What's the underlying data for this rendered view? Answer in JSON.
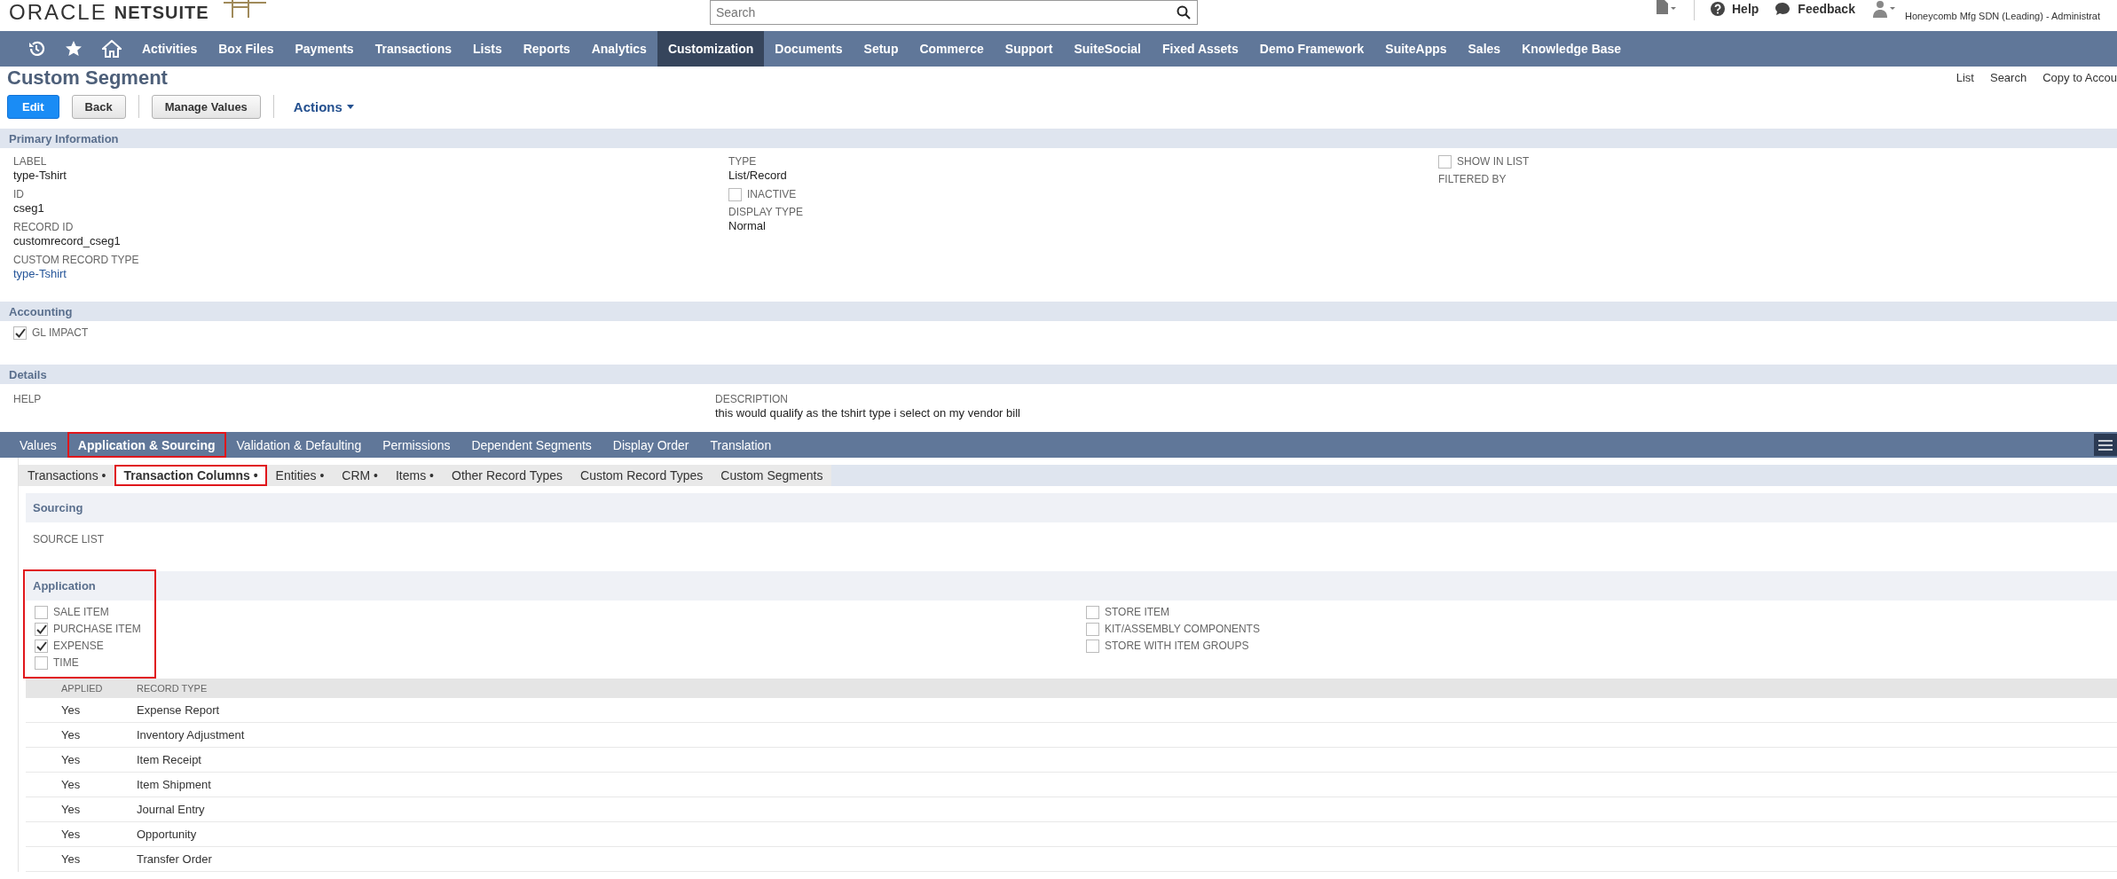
{
  "header": {
    "brand_primary": "ORACLE",
    "brand_secondary": "NETSUITE",
    "search": {
      "placeholder": "Search"
    },
    "links": [
      "Help",
      "Feedback"
    ],
    "account": "Honeycomb Mfg SDN (Leading) - Administrat"
  },
  "nav": {
    "items": [
      {
        "label": "Activities",
        "selected": false
      },
      {
        "label": "Box Files",
        "selected": false
      },
      {
        "label": "Payments",
        "selected": false
      },
      {
        "label": "Transactions",
        "selected": false
      },
      {
        "label": "Lists",
        "selected": false
      },
      {
        "label": "Reports",
        "selected": false
      },
      {
        "label": "Analytics",
        "selected": false
      },
      {
        "label": "Customization",
        "selected": true
      },
      {
        "label": "Documents",
        "selected": false
      },
      {
        "label": "Setup",
        "selected": false
      },
      {
        "label": "Commerce",
        "selected": false
      },
      {
        "label": "Support",
        "selected": false
      },
      {
        "label": "SuiteSocial",
        "selected": false
      },
      {
        "label": "Fixed Assets",
        "selected": false
      },
      {
        "label": "Demo Framework",
        "selected": false
      },
      {
        "label": "SuiteApps",
        "selected": false
      },
      {
        "label": "Sales",
        "selected": false
      },
      {
        "label": "Knowledge Base",
        "selected": false
      }
    ]
  },
  "page": {
    "title": "Custom Segment",
    "links": [
      "List",
      "Search",
      "Copy to Accou"
    ],
    "buttons": [
      {
        "label": "Edit",
        "kind": "primary"
      },
      {
        "label": "Back",
        "kind": "secondary"
      },
      {
        "label": "Manage Values",
        "kind": "secondary"
      }
    ],
    "actions": "Actions"
  },
  "primary_information": {
    "title": "Primary Information",
    "columns": [
      [
        {
          "kind": "field",
          "label": "LABEL",
          "value": "type-Tshirt"
        },
        {
          "kind": "field",
          "label": "ID",
          "value": "cseg1"
        },
        {
          "kind": "field",
          "label": "RECORD ID",
          "value": "customrecord_cseg1"
        },
        {
          "kind": "link",
          "label": "CUSTOM RECORD TYPE",
          "value": "type-Tshirt"
        }
      ],
      [
        {
          "kind": "field",
          "label": "TYPE",
          "value": "List/Record"
        },
        {
          "kind": "checkbox",
          "label": "INACTIVE",
          "checked": false
        },
        {
          "kind": "field",
          "label": "DISPLAY TYPE",
          "value": "Normal"
        }
      ],
      [
        {
          "kind": "checkbox",
          "label": "SHOW IN LIST",
          "checked": false
        },
        {
          "kind": "label",
          "label": "FILTERED BY"
        }
      ]
    ]
  },
  "accounting": {
    "title": "Accounting",
    "checkbox": {
      "label": "GL IMPACT",
      "checked": true
    }
  },
  "details": {
    "title": "Details",
    "help_label": "HELP",
    "description_label": "DESCRIPTION",
    "description": "this would qualify as the tshirt type i select on my vendor bill"
  },
  "tabs": [
    {
      "label": "Values",
      "selected": false,
      "highlighted": false
    },
    {
      "label": "Application & Sourcing",
      "selected": true,
      "highlighted": true
    },
    {
      "label": "Validation & Defaulting",
      "selected": false,
      "highlighted": false
    },
    {
      "label": "Permissions",
      "selected": false,
      "highlighted": false
    },
    {
      "label": "Dependent Segments",
      "selected": false,
      "highlighted": false
    },
    {
      "label": "Display Order",
      "selected": false,
      "highlighted": false
    },
    {
      "label": "Translation",
      "selected": false,
      "highlighted": false
    }
  ],
  "subtabs": [
    {
      "label": "Transactions •",
      "selected": false,
      "highlighted": false
    },
    {
      "label": "Transaction Columns •",
      "selected": true,
      "highlighted": true
    },
    {
      "label": "Entities •",
      "selected": false,
      "highlighted": false
    },
    {
      "label": "CRM •",
      "selected": false,
      "highlighted": false
    },
    {
      "label": "Items •",
      "selected": false,
      "highlighted": false
    },
    {
      "label": "Other Record Types",
      "selected": false,
      "highlighted": false
    },
    {
      "label": "Custom Record Types",
      "selected": false,
      "highlighted": false
    },
    {
      "label": "Custom Segments",
      "selected": false,
      "highlighted": false
    }
  ],
  "sourcing": {
    "title": "Sourcing",
    "source_list_label": "SOURCE LIST"
  },
  "application": {
    "title": "Application",
    "highlighted": true,
    "left": [
      {
        "label": "SALE ITEM",
        "checked": false
      },
      {
        "label": "PURCHASE ITEM",
        "checked": true
      },
      {
        "label": "EXPENSE",
        "checked": true
      },
      {
        "label": "TIME",
        "checked": false
      }
    ],
    "right": [
      {
        "label": "STORE ITEM",
        "checked": false
      },
      {
        "label": "KIT/ASSEMBLY COMPONENTS",
        "checked": false
      },
      {
        "label": "STORE WITH ITEM GROUPS",
        "checked": false
      }
    ]
  },
  "table": {
    "columns": [
      "APPLIED",
      "RECORD TYPE"
    ],
    "rows": [
      [
        "Yes",
        "Expense Report"
      ],
      [
        "Yes",
        "Inventory Adjustment"
      ],
      [
        "Yes",
        "Item Receipt"
      ],
      [
        "Yes",
        "Item Shipment"
      ],
      [
        "Yes",
        "Journal Entry"
      ],
      [
        "Yes",
        "Opportunity"
      ],
      [
        "Yes",
        "Transfer Order"
      ]
    ]
  }
}
